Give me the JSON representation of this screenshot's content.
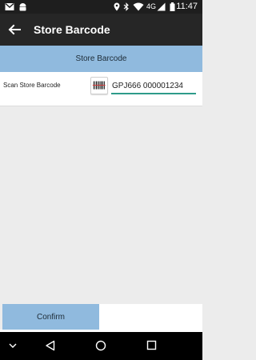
{
  "status_bar": {
    "time": "11:47",
    "network": "4G",
    "icons": [
      "gmail-icon",
      "android-icon",
      "location-icon",
      "bluetooth-icon",
      "wifi-icon",
      "signal-icon",
      "battery-icon"
    ]
  },
  "app_bar": {
    "title": "Store Barcode",
    "back_icon": "arrow-back-icon"
  },
  "section": {
    "header": "Store Barcode"
  },
  "scan": {
    "label": "Scan Store Barcode",
    "value": "GPJ666 000001234",
    "barcode_icon": "barcode-icon"
  },
  "actions": {
    "confirm_label": "Confirm"
  },
  "nav_bar": {
    "icons": [
      "chevron-down-icon",
      "back-triangle-icon",
      "home-circle-icon",
      "recents-square-icon"
    ]
  },
  "colors": {
    "accent": "#90bade",
    "app_bar": "#262626",
    "input_underline": "#2e9b8a"
  }
}
